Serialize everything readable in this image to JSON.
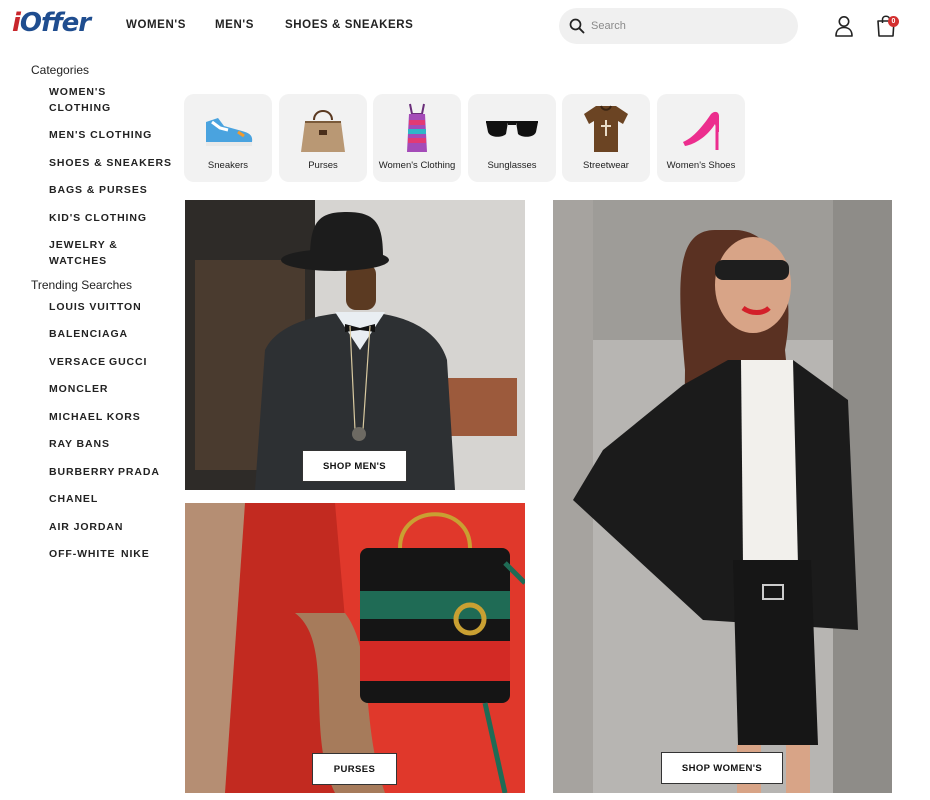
{
  "header": {
    "logo_i": "i",
    "logo_rest": "Offer",
    "nav": [
      "WOMEN'S",
      "MEN'S",
      "SHOES & SNEAKERS"
    ],
    "search_placeholder": "Search",
    "cart_count": "0",
    "icons": {
      "search": "search-icon",
      "account": "user-icon",
      "cart": "shopping-bag-icon"
    }
  },
  "sidebar": {
    "categories_heading": "Categories",
    "categories": [
      "WOMEN'S CLOTHING",
      "MEN'S CLOTHING",
      "SHOES & SNEAKERS",
      "BAGS & PURSES",
      "KID'S CLOTHING",
      "JEWELRY & WATCHES"
    ],
    "trending_heading": "Trending Searches",
    "trending": [
      "LOUIS VUITTON",
      "BALENCIAGA",
      "VERSACE",
      "GUCCI",
      "MONCLER",
      "MICHAEL KORS",
      "RAY BANS",
      "BURBERRY",
      "PRADA",
      "CHANEL",
      "AIR JORDAN",
      "OFF-WHITE",
      "NIKE"
    ]
  },
  "tiles": [
    "Sneakers",
    "Purses",
    "Women's Clothing",
    "Sunglasses",
    "Streetwear",
    "Women's Shoes"
  ],
  "promos": {
    "mens_cta": "SHOP MEN'S",
    "purses_cta": "PURSES",
    "womens_cta": "SHOP WOMEN'S"
  },
  "colors": {
    "logo_red": "#c8262c",
    "logo_blue": "#1f4d8f",
    "badge_red": "#d32f2f",
    "tile_bg": "#f2f2f2"
  }
}
